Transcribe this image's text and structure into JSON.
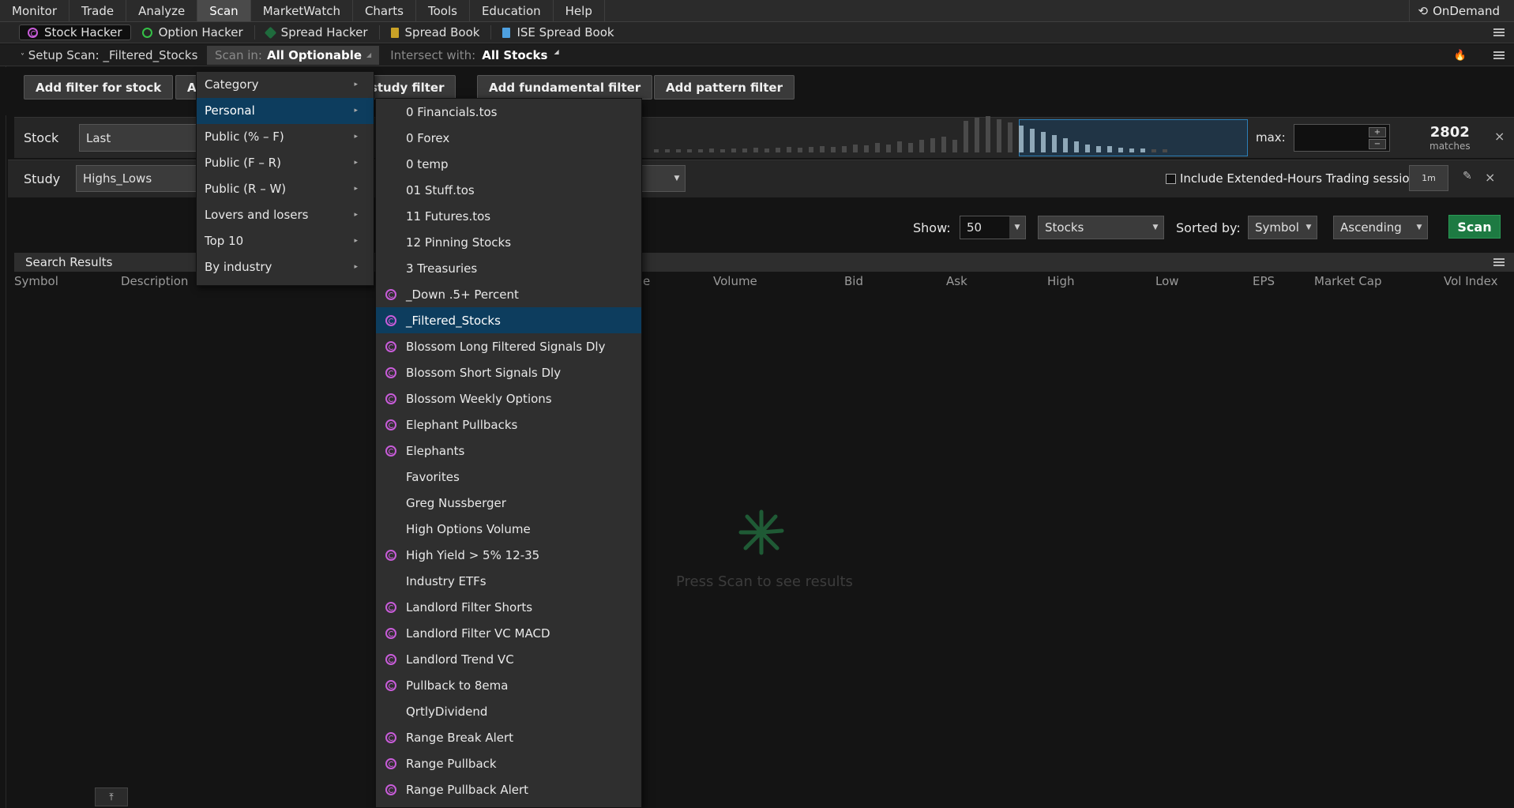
{
  "top_menu": [
    {
      "label": "Monitor",
      "active": false
    },
    {
      "label": "Trade",
      "active": false
    },
    {
      "label": "Analyze",
      "active": false
    },
    {
      "label": "Scan",
      "active": true
    },
    {
      "label": "MarketWatch",
      "active": false
    },
    {
      "label": "Charts",
      "active": false
    },
    {
      "label": "Tools",
      "active": false
    },
    {
      "label": "Education",
      "active": false
    },
    {
      "label": "Help",
      "active": false
    }
  ],
  "ondemand_label": "OnDemand",
  "sub_tabs": [
    {
      "label": "Stock Hacker",
      "icon": "spiral-icon"
    },
    {
      "label": "Option Hacker",
      "icon": "check-circle-icon"
    },
    {
      "label": "Spread Hacker",
      "icon": "spread-icon"
    },
    {
      "label": "Spread Book",
      "icon": "book-icon"
    },
    {
      "label": "ISE Spread Book",
      "icon": "document-icon"
    }
  ],
  "setup": {
    "title": "Setup Scan: _Filtered_Stocks",
    "scan_in_label": "Scan in:",
    "scan_in_value": "All Optionable",
    "intersect_label": "Intersect with:",
    "intersect_value": "All Stocks"
  },
  "filter_buttons": {
    "stock": "Add filter for stock",
    "study_partial": "d study filter",
    "fundamental": "Add fundamental filter",
    "pattern": "Add pattern filter"
  },
  "stock_row": {
    "label": "Stock",
    "select_value": "Last",
    "max_label": "max:",
    "matches_count": "2802",
    "matches_label": "matches"
  },
  "study_row": {
    "label": "Study",
    "select_value": "Highs_Lows",
    "extended_hours_label": "Include Extended-Hours Trading session",
    "timeframe": "1m"
  },
  "show_bar": {
    "show_label": "Show:",
    "show_value": "50",
    "type_value": "Stocks",
    "sorted_label": "Sorted by:",
    "sort_field": "Symbol",
    "sort_order": "Ascending",
    "scan_button": "Scan"
  },
  "results": {
    "title": "Search Results",
    "columns": [
      "Symbol",
      "Description",
      "e",
      "Volume",
      "Bid",
      "Ask",
      "High",
      "Low",
      "EPS",
      "Market Cap",
      "Vol Index"
    ],
    "empty_message": "Press Scan to see results"
  },
  "category_menu": [
    {
      "label": "Category",
      "highlighted": false
    },
    {
      "label": "Personal",
      "highlighted": true
    },
    {
      "label": "Public (% – F)",
      "highlighted": false
    },
    {
      "label": "Public (F – R)",
      "highlighted": false
    },
    {
      "label": "Public (R – W)",
      "highlighted": false
    },
    {
      "label": "Lovers and losers",
      "highlighted": false
    },
    {
      "label": "Top 10",
      "highlighted": false
    },
    {
      "label": "By industry",
      "highlighted": false
    }
  ],
  "personal_menu": [
    {
      "label": "0 Financials.tos",
      "icon": false,
      "highlighted": false
    },
    {
      "label": "0 Forex",
      "icon": false,
      "highlighted": false
    },
    {
      "label": "0 temp",
      "icon": false,
      "highlighted": false
    },
    {
      "label": "01 Stuff.tos",
      "icon": false,
      "highlighted": false
    },
    {
      "label": "11 Futures.tos",
      "icon": false,
      "highlighted": false
    },
    {
      "label": "12 Pinning Stocks",
      "icon": false,
      "highlighted": false
    },
    {
      "label": "3 Treasuries",
      "icon": false,
      "highlighted": false
    },
    {
      "label": "_Down .5+ Percent",
      "icon": true,
      "highlighted": false
    },
    {
      "label": "_Filtered_Stocks",
      "icon": true,
      "highlighted": true
    },
    {
      "label": "Blossom Long Filtered Signals Dly",
      "icon": true,
      "highlighted": false
    },
    {
      "label": "Blossom Short Signals Dly",
      "icon": true,
      "highlighted": false
    },
    {
      "label": "Blossom Weekly Options",
      "icon": true,
      "highlighted": false
    },
    {
      "label": "Elephant Pullbacks",
      "icon": true,
      "highlighted": false
    },
    {
      "label": "Elephants",
      "icon": true,
      "highlighted": false
    },
    {
      "label": "Favorites",
      "icon": false,
      "highlighted": false
    },
    {
      "label": "Greg Nussberger",
      "icon": false,
      "highlighted": false
    },
    {
      "label": "High Options Volume",
      "icon": false,
      "highlighted": false
    },
    {
      "label": "High Yield > 5% 12-35",
      "icon": true,
      "highlighted": false
    },
    {
      "label": "Industry ETFs",
      "icon": false,
      "highlighted": false
    },
    {
      "label": "Landlord Filter Shorts",
      "icon": true,
      "highlighted": false
    },
    {
      "label": "Landlord Filter VC MACD",
      "icon": true,
      "highlighted": false
    },
    {
      "label": "Landlord Trend VC",
      "icon": true,
      "highlighted": false
    },
    {
      "label": "Pullback to 8ema",
      "icon": true,
      "highlighted": false
    },
    {
      "label": "QrtlyDividend",
      "icon": false,
      "highlighted": false
    },
    {
      "label": "Range Break Alert",
      "icon": true,
      "highlighted": false
    },
    {
      "label": "Range Pullback",
      "icon": true,
      "highlighted": false
    },
    {
      "label": "Range Pullback Alert",
      "icon": true,
      "highlighted": false
    }
  ],
  "colors": {
    "accent_highlight": "#0d3d5e",
    "scan_green": "#1d7a42",
    "spiral_pink": "#c85cd9"
  }
}
